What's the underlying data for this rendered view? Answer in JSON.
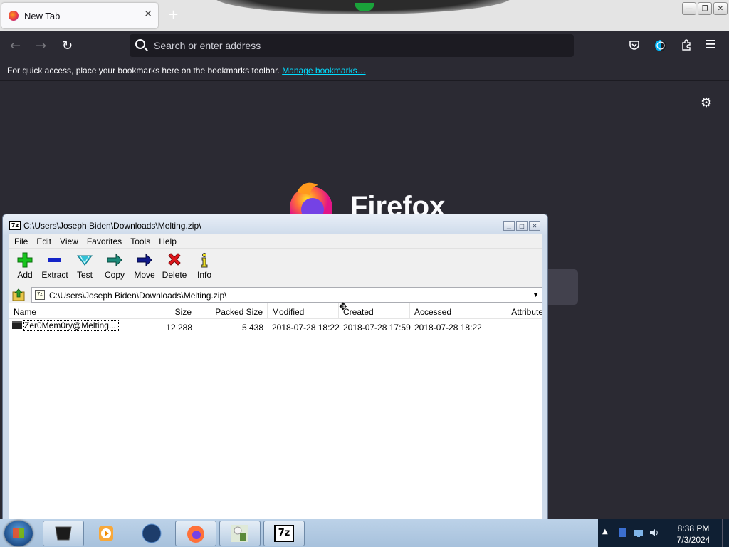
{
  "firefox": {
    "tab": {
      "title": "New Tab",
      "close": "✕"
    },
    "newtab": "+",
    "window_buttons": {
      "min": "—",
      "max": "❐",
      "close": "✕"
    },
    "nav": {
      "back": "←",
      "forward": "→",
      "reload": "↻",
      "search_placeholder": "Search or enter address"
    },
    "bookmarks": {
      "message": "For quick access, place your bookmarks here on the bookmarks toolbar.",
      "link": "Manage bookmarks…"
    },
    "brand": "Firefox"
  },
  "sevenzip": {
    "title": "C:\\Users\\Joseph Biden\\Downloads\\Melting.zip\\",
    "menu": [
      "File",
      "Edit",
      "View",
      "Favorites",
      "Tools",
      "Help"
    ],
    "toolbar": [
      {
        "label": "Add",
        "icon": "add-icon"
      },
      {
        "label": "Extract",
        "icon": "extract-icon"
      },
      {
        "label": "Test",
        "icon": "test-icon"
      },
      {
        "label": "Copy",
        "icon": "copy-icon"
      },
      {
        "label": "Move",
        "icon": "move-icon"
      },
      {
        "label": "Delete",
        "icon": "delete-icon"
      },
      {
        "label": "Info",
        "icon": "info-icon"
      }
    ],
    "path": "C:\\Users\\Joseph Biden\\Downloads\\Melting.zip\\",
    "columns": [
      "Name",
      "Size",
      "Packed Size",
      "Modified",
      "Created",
      "Accessed",
      "Attributes"
    ],
    "rows": [
      {
        "name": "Zer0Mem0ry@Melting....",
        "size": "12 288",
        "packed": "5 438",
        "modified": "2018-07-28 18:22",
        "created": "2018-07-28 17:59",
        "accessed": "2018-07-28 18:22",
        "attributes": ""
      }
    ]
  },
  "taskbar": {
    "clock_time": "8:38 PM",
    "clock_date": "7/3/2024",
    "seven_zip_label": "7z"
  },
  "colors": {
    "firefox_bg": "#2b2a33",
    "link": "#00ddff",
    "taskbar": "#a7c1dc"
  }
}
